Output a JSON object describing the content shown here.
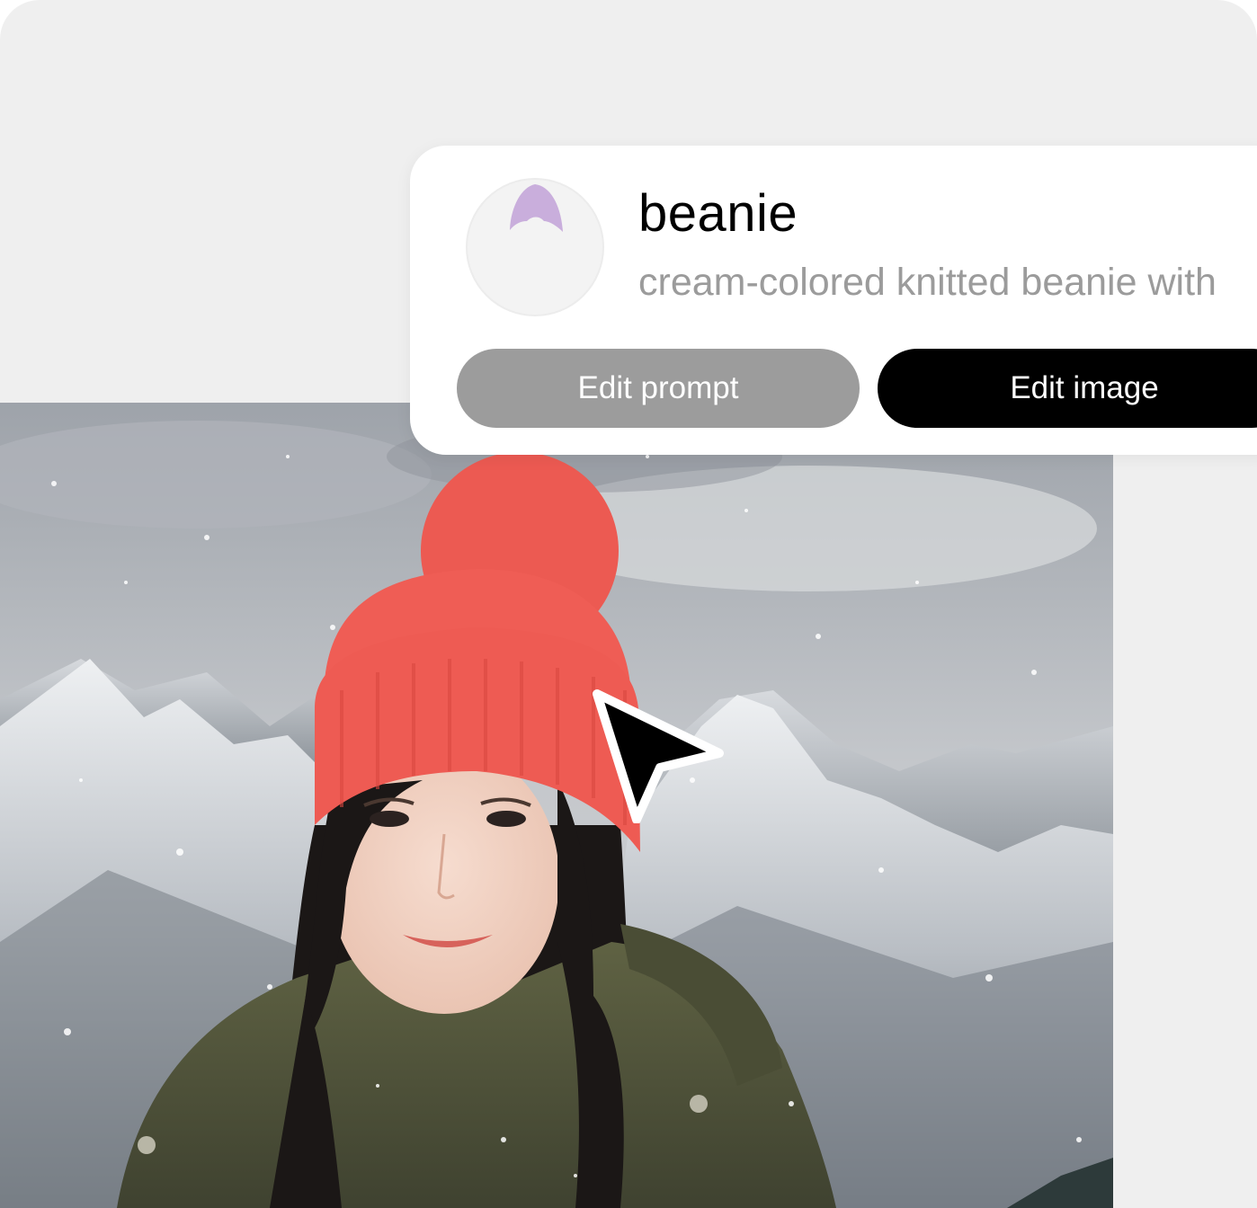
{
  "item_card": {
    "title": "beanie",
    "description": "cream-colored knitted beanie with",
    "thumbnail_icon": "beanie-icon",
    "edit_prompt_label": "Edit prompt",
    "edit_image_label": "Edit image"
  },
  "colors": {
    "panel_background": "#efefef",
    "card_background": "#ffffff",
    "edit_prompt_button": "#9c9c9c",
    "edit_image_button": "#000000",
    "thumbnail_beanie": "#c9aedc",
    "beanie": "#ef5a52"
  },
  "photo": {
    "subject": "woman-wearing-red-beanie-in-snowy-mountains"
  },
  "cursor_icon": "arrow-cursor-icon"
}
